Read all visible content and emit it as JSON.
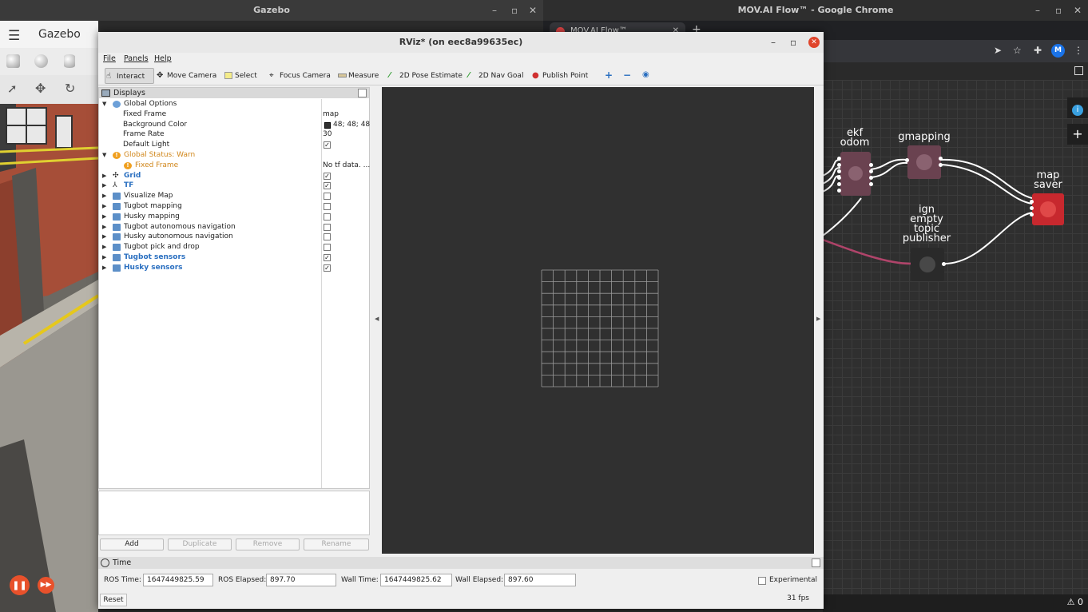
{
  "gazebo": {
    "window_title": "Gazebo",
    "header_title": "Gazebo",
    "menu_icon": "hamburger-icon"
  },
  "chrome": {
    "window_title": "MOV.AI Flow™ - Google Chrome",
    "tab_title": "MOV.AI Flow™",
    "avatar_letter": "M",
    "status_count": "0",
    "nodes": {
      "ekf_odom": "ekf\nodom",
      "gmapping": "gmapping",
      "map_saver": "map\nsaver",
      "ign_publisher": "ign\nempty\ntopic\npublisher"
    },
    "colors": {
      "node_maroon": "#6a4250",
      "node_dark": "#2a2a2a",
      "node_red": "#c7282e",
      "link_pink": "#b0446a"
    }
  },
  "rviz": {
    "window_title": "RViz* (on eec8a99635ec)",
    "menu": {
      "file": "File",
      "panels": "Panels",
      "help": "Help"
    },
    "toolbar": {
      "interact": "Interact",
      "move_camera": "Move Camera",
      "select": "Select",
      "focus_camera": "Focus Camera",
      "measure": "Measure",
      "pose_estimate": "2D Pose Estimate",
      "nav_goal": "2D Nav Goal",
      "publish_point": "Publish Point"
    },
    "displays": {
      "header": "Displays",
      "global_options": "Global Options",
      "fixed_frame_label": "Fixed Frame",
      "fixed_frame_value": "map",
      "bg_color_label": "Background Color",
      "bg_color_value": "48; 48; 48",
      "frame_rate_label": "Frame Rate",
      "frame_rate_value": "30",
      "default_light_label": "Default Light",
      "global_status": "Global Status: Warn",
      "status_fixed_frame": "Fixed Frame",
      "status_fixed_frame_value": "No tf data. ...",
      "items": [
        {
          "label": "Grid",
          "checked": "✓"
        },
        {
          "label": "TF",
          "checked": "✓"
        },
        {
          "label": "Visualize Map",
          "checked": ""
        },
        {
          "label": "Tugbot mapping",
          "checked": ""
        },
        {
          "label": "Husky mapping",
          "checked": ""
        },
        {
          "label": "Tugbot autonomous navigation",
          "checked": ""
        },
        {
          "label": "Husky autonomous navigation",
          "checked": ""
        },
        {
          "label": "Tugbot pick and drop",
          "checked": ""
        },
        {
          "label": "Tugbot sensors",
          "checked": "✓"
        },
        {
          "label": "Husky sensors",
          "checked": "✓"
        }
      ],
      "default_light_checked": "✓"
    },
    "buttons": {
      "add": "Add",
      "duplicate": "Duplicate",
      "remove": "Remove",
      "rename": "Rename"
    },
    "time": {
      "header": "Time",
      "ros_time_label": "ROS Time:",
      "ros_time_value": "1647449825.59",
      "ros_elapsed_label": "ROS Elapsed:",
      "ros_elapsed_value": "897.70",
      "wall_time_label": "Wall Time:",
      "wall_time_value": "1647449825.62",
      "wall_elapsed_label": "Wall Elapsed:",
      "wall_elapsed_value": "897.60",
      "experimental": "Experimental",
      "reset": "Reset",
      "fps": "31 fps"
    },
    "colors": {
      "view_bg": "#303030",
      "grid": "#a0a0a0",
      "warn": "#d0861a",
      "enabled": "#2a6fc0"
    }
  }
}
